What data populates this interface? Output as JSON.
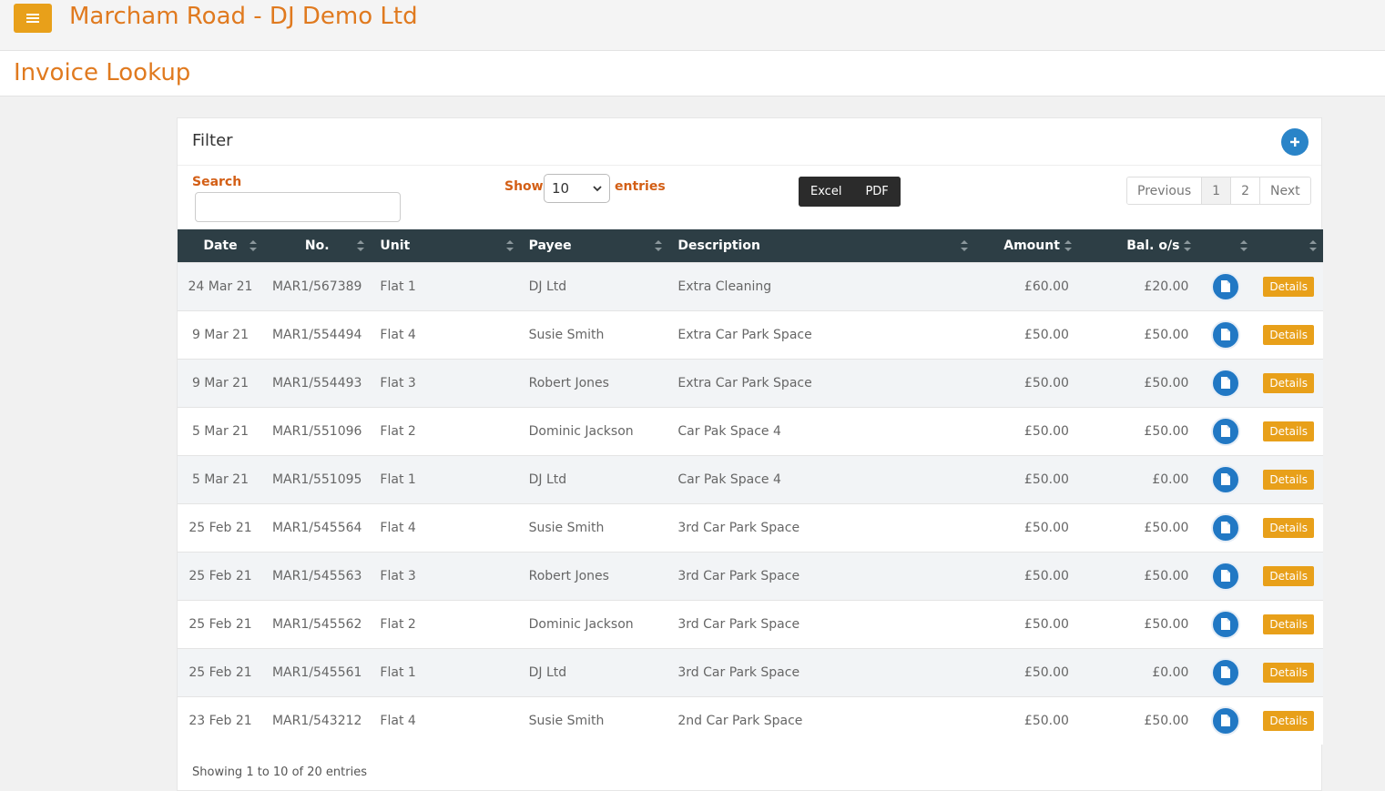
{
  "header": {
    "site_title": "Marcham Road - DJ Demo Ltd"
  },
  "page": {
    "title": "Invoice Lookup"
  },
  "filter": {
    "title": "Filter",
    "search_label": "Search",
    "search_value": "",
    "show_label": "Show",
    "entries_value": "10",
    "entries_label": "entries",
    "excel_label": "Excel",
    "pdf_label": "PDF"
  },
  "pager": {
    "previous": "Previous",
    "page1": "1",
    "page2": "2",
    "next": "Next"
  },
  "table": {
    "headers": {
      "date": "Date",
      "no": "No.",
      "unit": "Unit",
      "payee": "Payee",
      "description": "Description",
      "amount": "Amount",
      "balance": "Bal. o/s"
    },
    "details_label": "Details",
    "rows": [
      {
        "date": "24 Mar 21",
        "no": "MAR1/567389",
        "unit": "Flat 1",
        "payee": "DJ Ltd",
        "description": "Extra Cleaning",
        "amount": "£60.00",
        "balance": "£20.00"
      },
      {
        "date": "9 Mar 21",
        "no": "MAR1/554494",
        "unit": "Flat 4",
        "payee": "Susie Smith",
        "description": "Extra Car Park Space",
        "amount": "£50.00",
        "balance": "£50.00"
      },
      {
        "date": "9 Mar 21",
        "no": "MAR1/554493",
        "unit": "Flat 3",
        "payee": "Robert Jones",
        "description": "Extra Car Park Space",
        "amount": "£50.00",
        "balance": "£50.00"
      },
      {
        "date": "5 Mar 21",
        "no": "MAR1/551096",
        "unit": "Flat 2",
        "payee": "Dominic Jackson",
        "description": "Car Pak Space 4",
        "amount": "£50.00",
        "balance": "£50.00"
      },
      {
        "date": "5 Mar 21",
        "no": "MAR1/551095",
        "unit": "Flat 1",
        "payee": "DJ Ltd",
        "description": "Car Pak Space 4",
        "amount": "£50.00",
        "balance": "£0.00"
      },
      {
        "date": "25 Feb 21",
        "no": "MAR1/545564",
        "unit": "Flat 4",
        "payee": "Susie Smith",
        "description": "3rd Car Park Space",
        "amount": "£50.00",
        "balance": "£50.00"
      },
      {
        "date": "25 Feb 21",
        "no": "MAR1/545563",
        "unit": "Flat 3",
        "payee": "Robert Jones",
        "description": "3rd Car Park Space",
        "amount": "£50.00",
        "balance": "£50.00"
      },
      {
        "date": "25 Feb 21",
        "no": "MAR1/545562",
        "unit": "Flat 2",
        "payee": "Dominic Jackson",
        "description": "3rd Car Park Space",
        "amount": "£50.00",
        "balance": "£50.00"
      },
      {
        "date": "25 Feb 21",
        "no": "MAR1/545561",
        "unit": "Flat 1",
        "payee": "DJ Ltd",
        "description": "3rd Car Park Space",
        "amount": "£50.00",
        "balance": "£0.00"
      },
      {
        "date": "23 Feb 21",
        "no": "MAR1/543212",
        "unit": "Flat 4",
        "payee": "Susie Smith",
        "description": "2nd Car Park Space",
        "amount": "£50.00",
        "balance": "£50.00"
      }
    ]
  },
  "footer": {
    "info": "Showing 1 to 10 of 20 entries"
  },
  "icons": {
    "menu": "hamburger-icon",
    "add": "plus-icon",
    "document": "document-icon",
    "sort": "sort-icon",
    "dropdown": "chevron-down-icon"
  },
  "colors": {
    "accent": "#e8a01a",
    "title": "#e07a1f",
    "header_bg": "#2d3e45",
    "doc_button": "#2178c4"
  }
}
